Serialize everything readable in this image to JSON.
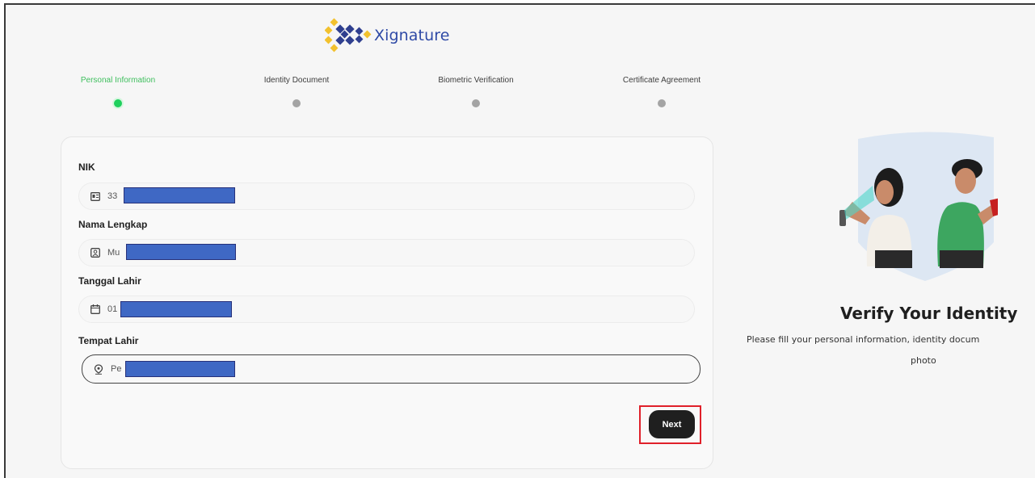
{
  "brand": {
    "name": "Xignature"
  },
  "stepper": {
    "steps": [
      {
        "label": "Personal Information",
        "active": true
      },
      {
        "label": "Identity Document",
        "active": false
      },
      {
        "label": "Biometric Verification",
        "active": false
      },
      {
        "label": "Certificate Agreement",
        "active": false
      }
    ]
  },
  "form": {
    "fields": [
      {
        "label": "NIK",
        "value": "33",
        "icon": "id-card-icon"
      },
      {
        "label": "Nama Lengkap",
        "value": "Mu",
        "icon": "person-box-icon"
      },
      {
        "label": "Tanggal Lahir",
        "value": "01",
        "icon": "calendar-icon"
      },
      {
        "label": "Tempat Lahir",
        "value": "Pe",
        "icon": "location-pin-icon"
      }
    ],
    "next_label": "Next"
  },
  "side": {
    "title": "Verify Your Identity",
    "description_line1": "Please fill your personal information, identity docum",
    "description_line2": "photo"
  },
  "colors": {
    "accent_green": "#1fd05d",
    "brand_blue": "#2f4aa6",
    "brand_yellow": "#f2c12e",
    "button_dark": "#1f1f1f",
    "highlight_red": "#e0202a",
    "redaction_blue": "#3f68c4"
  }
}
